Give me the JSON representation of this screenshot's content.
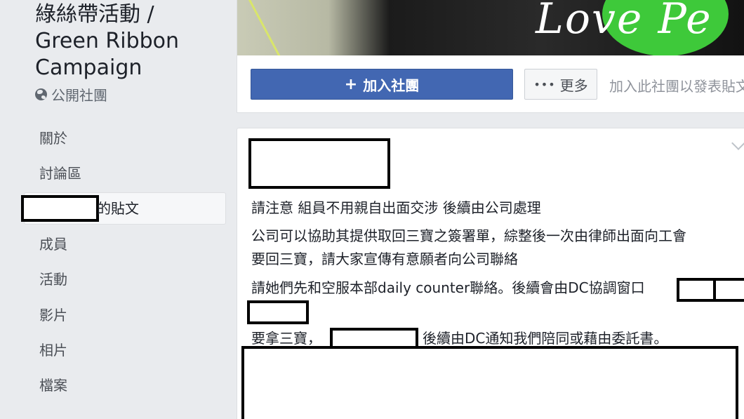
{
  "group": {
    "title_line1": "綠絲帶活動 /",
    "title_line2": "Green Ribbon",
    "title_line3": "Campaign",
    "privacy": "公開社團"
  },
  "nav": {
    "about": "關於",
    "discussion": "討論區",
    "my_posts_suffix": "的貼文",
    "members": "成員",
    "events": "活動",
    "videos": "影片",
    "photos": "相片",
    "files": "檔案"
  },
  "cover": {
    "text": "Love Pe"
  },
  "actions": {
    "join_label": "加入社團",
    "more_label": "更多",
    "join_hint": "加入此社團以發表貼文"
  },
  "post": {
    "line1": "請注意 組員不用親自出面交涉 後續由公司處理",
    "line2": "公司可以協助其提供取回三寶之簽署單，綜整後一次由律師出面向工會",
    "line3": "要回三寶，請大家宣傳有意願者向公司聯絡",
    "line4": "請她們先和空服本部daily counter聯絡。後續會由DC協調窗口",
    "line5a": "要拿三寶，",
    "line5b": "後續由DC通知我們陪同或藉由委託書。"
  },
  "colors": {
    "primary_button": "#4267b2",
    "background": "#e9ebee",
    "card": "#ffffff"
  },
  "icons": [
    "globe-icon",
    "plus-icon",
    "more-dots-icon",
    "chevron-down-icon"
  ]
}
